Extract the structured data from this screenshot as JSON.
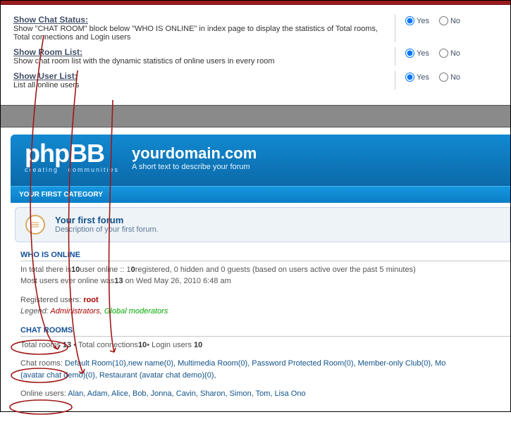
{
  "settings": [
    {
      "label": "Show Chat Status:",
      "desc": "Show \"CHAT ROOM\" block below \"WHO IS ONLINE\" in index page to display the statistics of Total rooms, Total connections and Login users",
      "yes": "Yes",
      "no": "No"
    },
    {
      "label": "Show Room List:",
      "desc": "Show chat room list with the dynamic statistics of online users in every room",
      "yes": "Yes",
      "no": "No"
    },
    {
      "label": "Show User List:",
      "desc": "List all online users",
      "yes": "Yes",
      "no": "No"
    }
  ],
  "header": {
    "domain": "yourdomain.com",
    "tagline": "A short text to describe your forum"
  },
  "category": {
    "title": "YOUR FIRST CATEGORY"
  },
  "forum": {
    "title": "Your first forum",
    "desc": "Description of your first forum."
  },
  "who": {
    "heading": "WHO IS ONLINE",
    "line1_a": "In total there is",
    "line1_n1": "10",
    "line1_b": "user online :: 1",
    "line1_n2": "0",
    "line1_c": "registered, 0 hidden and 0 guests (based on users active over the past 5 minutes)",
    "line2_a": "Most users ever online was",
    "line2_n": "13",
    "line2_b": " on Wed May 26, 2010 6:48 am",
    "reg_label": "Registered users: ",
    "reg_user": "root",
    "legend_label": "Legend: ",
    "admins": "Administrators",
    "mods": "Global moderators"
  },
  "chat": {
    "heading": "CHAT ROOMS",
    "totals_a": "Total rooms ",
    "totals_n1": "13",
    "totals_b": " • Total connections",
    "totals_n2": "10",
    "totals_c": "• Login users ",
    "totals_n3": "10",
    "rooms_label": "Chat rooms: ",
    "rooms_text": "Default Room(10),new name(0), Multimedia Room(0), Password Protected Room(0), Member-only Club(0), Mo",
    "rooms_text2": "(avatar chat demo)(0), Restaurant (avatar chat demo)(0),",
    "online_label": "Online users: ",
    "online_text": "Alan, Adam, Alice, Bob, Jonna, Cavin, Sharon, Simon, Tom, Lisa Ono"
  }
}
